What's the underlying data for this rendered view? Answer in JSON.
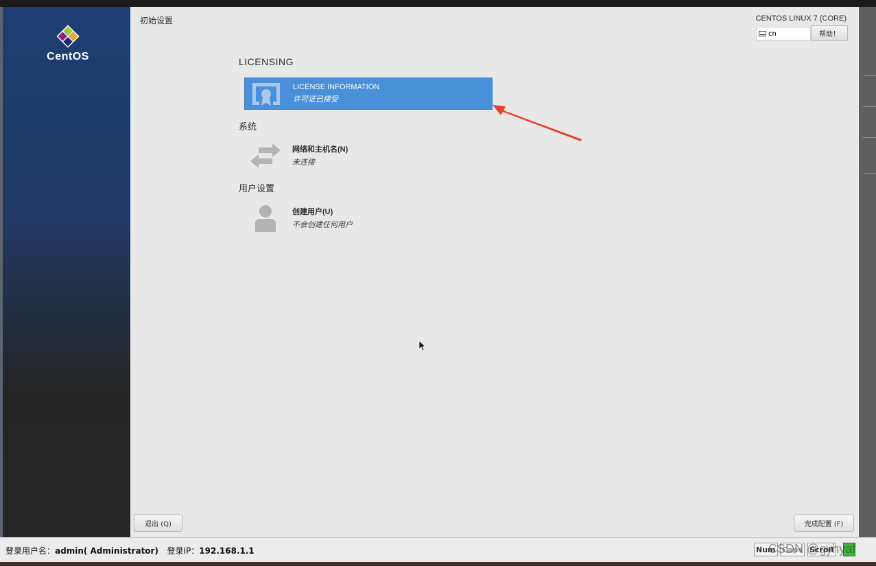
{
  "sidebar": {
    "logo_text": "CentOS"
  },
  "header": {
    "page_title": "初始设置",
    "product_title": "CENTOS LINUX 7 (CORE)",
    "keyboard_layout": "cn",
    "help_label": "帮助！"
  },
  "sections": [
    {
      "title": "LICENSING",
      "spokes": [
        {
          "name": "LICENSE INFORMATION",
          "status": "许可证已接受",
          "icon": "license-certificate-icon",
          "selected": true
        }
      ]
    },
    {
      "title": "系统",
      "spokes": [
        {
          "name": "网络和主机名(N)",
          "status": "未连接",
          "icon": "network-arrows-icon",
          "selected": false
        }
      ]
    },
    {
      "title": "用户设置",
      "spokes": [
        {
          "name": "创建用户(U)",
          "status": "不会创建任何用户",
          "icon": "user-icon",
          "selected": false
        }
      ]
    }
  ],
  "footer": {
    "quit_label": "退出 (Q)",
    "finish_label": "完成配置 (F)"
  },
  "statusbar": {
    "user_label": "登录用户名：",
    "user_value": "admin( Administrator)",
    "ip_label": "登录IP：",
    "ip_value": "192.168.1.1",
    "num_lock": "Num",
    "caps_lock": "Caps",
    "scroll_lock": "Scroll",
    "watermark": "CSDN @gyhyaf"
  },
  "colors": {
    "selected_spoke": "#4a90d9",
    "annotation_arrow": "#e8402c",
    "main_bg": "#e8e8e8"
  }
}
